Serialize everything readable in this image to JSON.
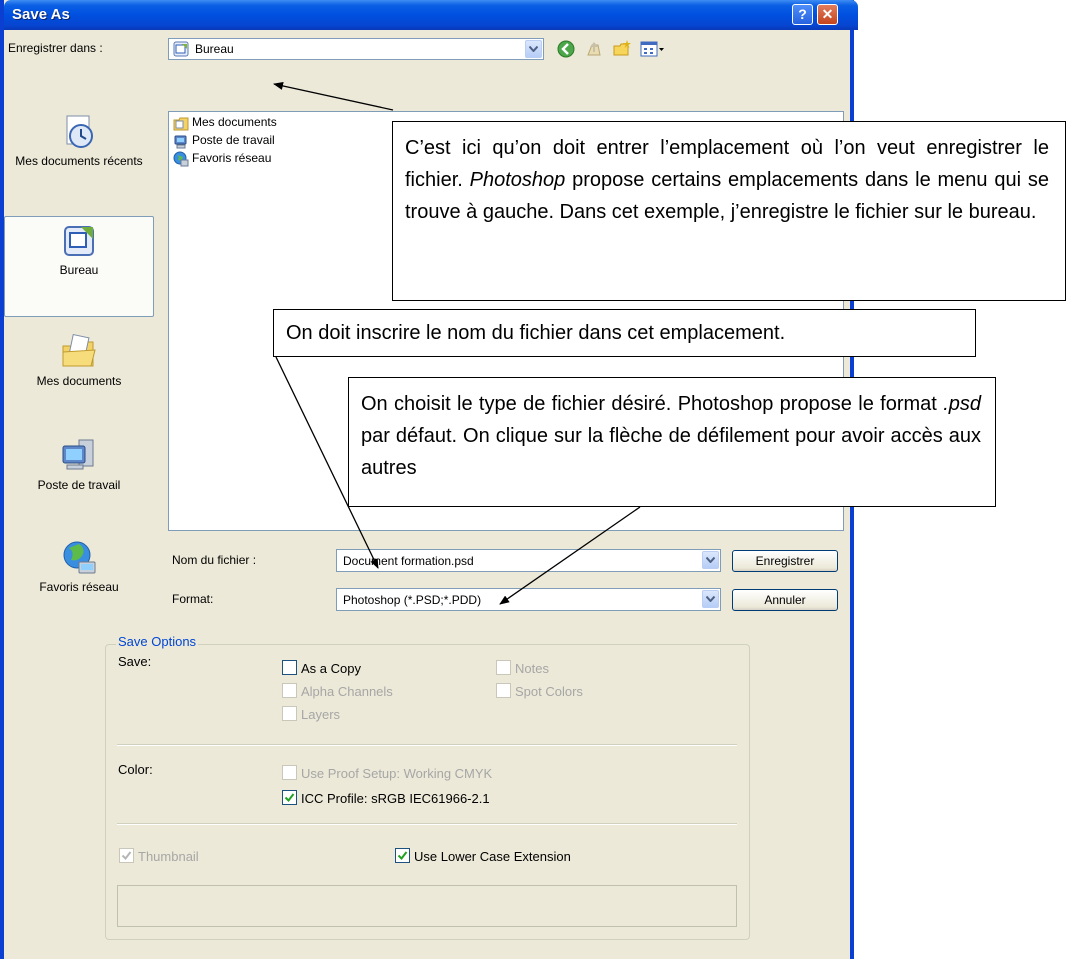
{
  "window": {
    "title": "Save As",
    "help_glyph": "?",
    "close_glyph": "✕"
  },
  "save_in": {
    "label": "Enregistrer dans :",
    "value": "Bureau"
  },
  "toolbar": {
    "icons": [
      "back-icon",
      "up-folder-icon",
      "new-folder-icon",
      "views-menu-icon"
    ]
  },
  "places": [
    {
      "label": "Mes documents récents",
      "icon": "recent-documents-icon"
    },
    {
      "label": "Bureau",
      "icon": "desktop-icon"
    },
    {
      "label": "Mes documents",
      "icon": "my-documents-icon"
    },
    {
      "label": "Poste de travail",
      "icon": "my-computer-icon"
    },
    {
      "label": "Favoris réseau",
      "icon": "network-places-icon"
    }
  ],
  "files": [
    {
      "label": "Mes documents",
      "icon": "my-documents-icon"
    },
    {
      "label": "Poste de travail",
      "icon": "my-computer-icon"
    },
    {
      "label": "Favoris réseau",
      "icon": "network-places-icon"
    }
  ],
  "filename": {
    "label": "Nom du fichier :",
    "value": "Document formation.psd"
  },
  "format": {
    "label": "Format:",
    "value": "Photoshop (*.PSD;*.PDD)"
  },
  "buttons": {
    "save": "Enregistrer",
    "cancel": "Annuler"
  },
  "save_options": {
    "title": "Save Options",
    "save_label": "Save:",
    "as_copy": {
      "label": "As a Copy",
      "checked": false,
      "enabled": true
    },
    "notes": {
      "label": "Notes",
      "checked": false,
      "enabled": false
    },
    "alpha_channels": {
      "label": "Alpha Channels",
      "checked": false,
      "enabled": false
    },
    "spot_colors": {
      "label": "Spot Colors",
      "checked": false,
      "enabled": false
    },
    "layers": {
      "label": "Layers",
      "checked": false,
      "enabled": false
    },
    "color_label": "Color:",
    "use_proof_setup": {
      "label": "Use Proof Setup:  Working CMYK",
      "checked": false,
      "enabled": false
    },
    "icc_profile": {
      "label": "ICC Profile:  sRGB IEC61966-2.1",
      "checked": true,
      "enabled": true
    },
    "thumbnail": {
      "label": "Thumbnail",
      "checked": true,
      "enabled": false
    },
    "lower_case_ext": {
      "label": "Use Lower Case Extension",
      "checked": true,
      "enabled": true
    }
  },
  "callouts": {
    "location": {
      "before": "C’est ici qu’on doit entrer l’emplacement où l’on veut enregistrer le fichier. ",
      "emphasis": "Photoshop",
      "after": " propose certains emplacements dans le menu qui se trouve à gauche. Dans cet exemple, j’enregistre le fichier sur le bureau."
    },
    "filename": "On doit inscrire le nom du fichier dans cet emplacement.",
    "format": {
      "before": "On choisit le type de fichier désiré. Photoshop propose le format ",
      "emphasis": ".psd",
      "after": " par défaut. On clique sur la flèche de défilement pour avoir accès aux autres"
    }
  },
  "colors": {
    "titlebar": "#0050e0",
    "dialog_bg": "#ece9d8",
    "group_title": "#0046d5",
    "disabled_text": "#a6a6a6"
  }
}
